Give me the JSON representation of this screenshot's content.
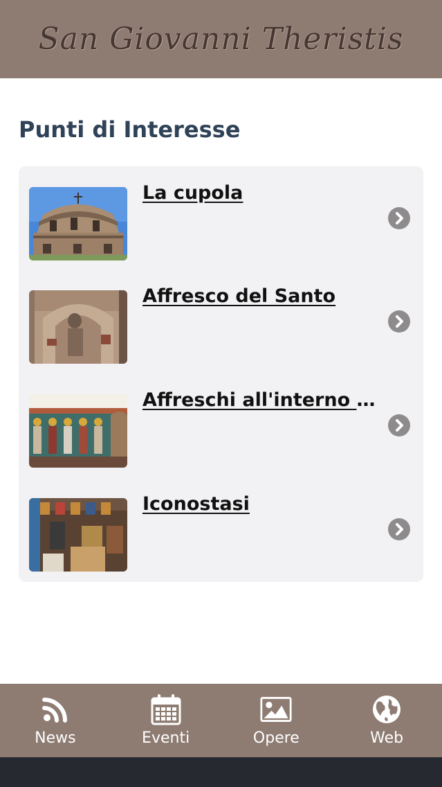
{
  "header": {
    "logo_text": "San Giovanni Theristis"
  },
  "page": {
    "title": "Punti di Interesse"
  },
  "poi_list": [
    {
      "title": "La cupola",
      "thumb_icon": "dome-photo"
    },
    {
      "title": "Affresco del Santo",
      "thumb_icon": "fresco-photo"
    },
    {
      "title": "Affreschi all'interno de...",
      "thumb_icon": "frescoes-photo"
    },
    {
      "title": "Iconostasi",
      "thumb_icon": "iconostasis-photo"
    }
  ],
  "tabbar": {
    "tabs": [
      {
        "label": "News",
        "icon": "rss-icon"
      },
      {
        "label": "Eventi",
        "icon": "calendar-icon"
      },
      {
        "label": "Opere",
        "icon": "image-icon"
      },
      {
        "label": "Web",
        "icon": "globe-icon"
      }
    ]
  },
  "colors": {
    "header_bg": "#8e7c73",
    "title": "#2f4258",
    "card_bg": "#f2f1f3",
    "chevron_bg": "#8d8b8c",
    "system_bar": "#262a30"
  }
}
